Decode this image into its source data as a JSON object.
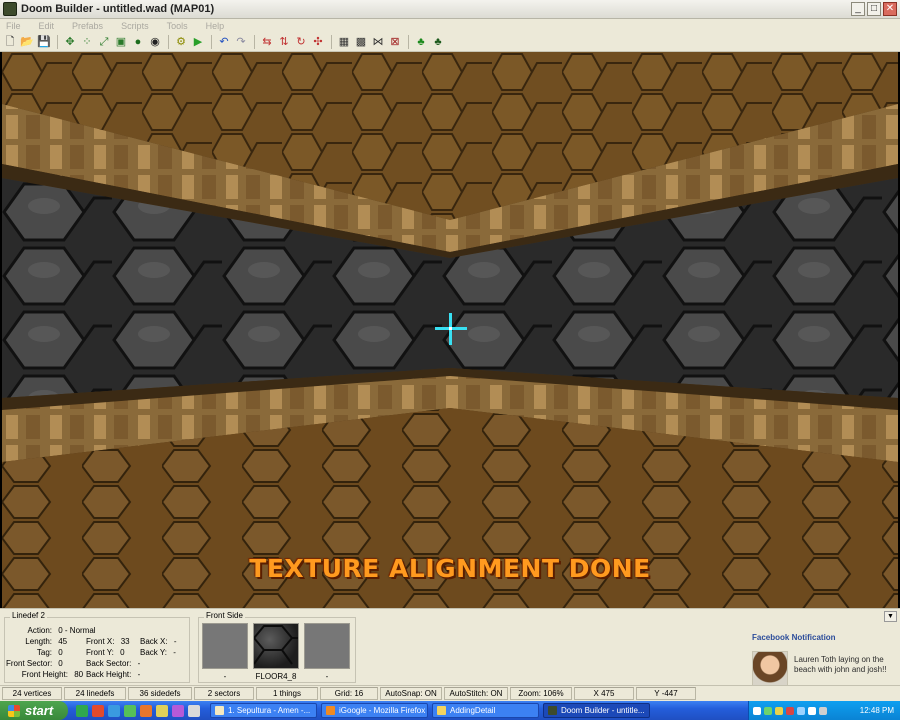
{
  "window": {
    "title": "Doom Builder - untitled.wad (MAP01)",
    "buttons": {
      "minimize": "_",
      "maximize": "□",
      "close": "✕"
    }
  },
  "menu": [
    "File",
    "Edit",
    "Prefabs",
    "Scripts",
    "Tools",
    "Help"
  ],
  "toolbar": {
    "icons": [
      "new-file-icon",
      "open-folder-icon",
      "save-icon",
      "sep",
      "move-icon",
      "vertices-mode-icon",
      "lines-mode-icon",
      "sectors-mode-icon",
      "things-mode-icon",
      "3d-mode-icon",
      "sep",
      "build-icon",
      "test-map-icon",
      "sep",
      "undo-icon",
      "redo-icon",
      "sep",
      "flip-linedef-icon",
      "flip-sidedef-icon",
      "rotate-icon",
      "resize-icon",
      "sep",
      "grid-icon",
      "snap-icon",
      "stitch-icon",
      "errors-icon",
      "sep",
      "tree-green-icon",
      "tree-dark-icon"
    ]
  },
  "viewport": {
    "message": "TEXTURE ALIGNMENT DONE"
  },
  "info": {
    "linedef_title": "Linedef 2",
    "action_label": "Action:",
    "action_value": "0 - Normal",
    "length_label": "Length:",
    "length_value": "45",
    "tag_label": "Tag:",
    "tag_value": "0",
    "front_sector_label": "Front Sector:",
    "front_sector_value": "0",
    "front_height_label": "Front Height:",
    "front_height_value": "80",
    "front_x_label": "Front X:",
    "front_x_value": "33",
    "front_y_label": "Front Y:",
    "front_y_value": "0",
    "back_sector_label": "Back Sector:",
    "back_sector_value": "-",
    "back_height_label": "Back Height:",
    "back_height_value": "-",
    "back_x_label": "Back X:",
    "back_x_value": "-",
    "back_y_label": "Back Y:",
    "back_y_value": "-",
    "front_side_title": "Front Side",
    "upper_texture": "-",
    "middle_texture": "FLOOR4_8",
    "lower_texture": "-"
  },
  "notification": {
    "title": "Facebook Notification",
    "text": "Lauren Toth laying on the beach with john and josh!!"
  },
  "status": [
    "24 vertices",
    "24 linedefs",
    "36 sidedefs",
    "2 sectors",
    "1 things",
    "Grid: 16",
    "AutoSnap: ON",
    "AutoStitch: ON",
    "Zoom: 106%",
    "X 475",
    "Y -447"
  ],
  "taskbar": {
    "start_label": "start",
    "tasks": [
      {
        "label": "1. Sepultura - Amen -...",
        "active": false
      },
      {
        "label": "iGoogle - Mozilla Firefox",
        "active": false
      },
      {
        "label": "AddingDetail",
        "active": false
      },
      {
        "label": "Doom Builder - untitle...",
        "active": true
      }
    ],
    "clock": "12:48 PM"
  },
  "colors": {
    "wall_stone": "#3c3c3c",
    "floor_brown": "#6b4a1e",
    "trim_tan": "#a07a45",
    "crosshair": "#39e0f2",
    "banner": "#ff9a1f",
    "taskbar_blue": "#245edb"
  }
}
